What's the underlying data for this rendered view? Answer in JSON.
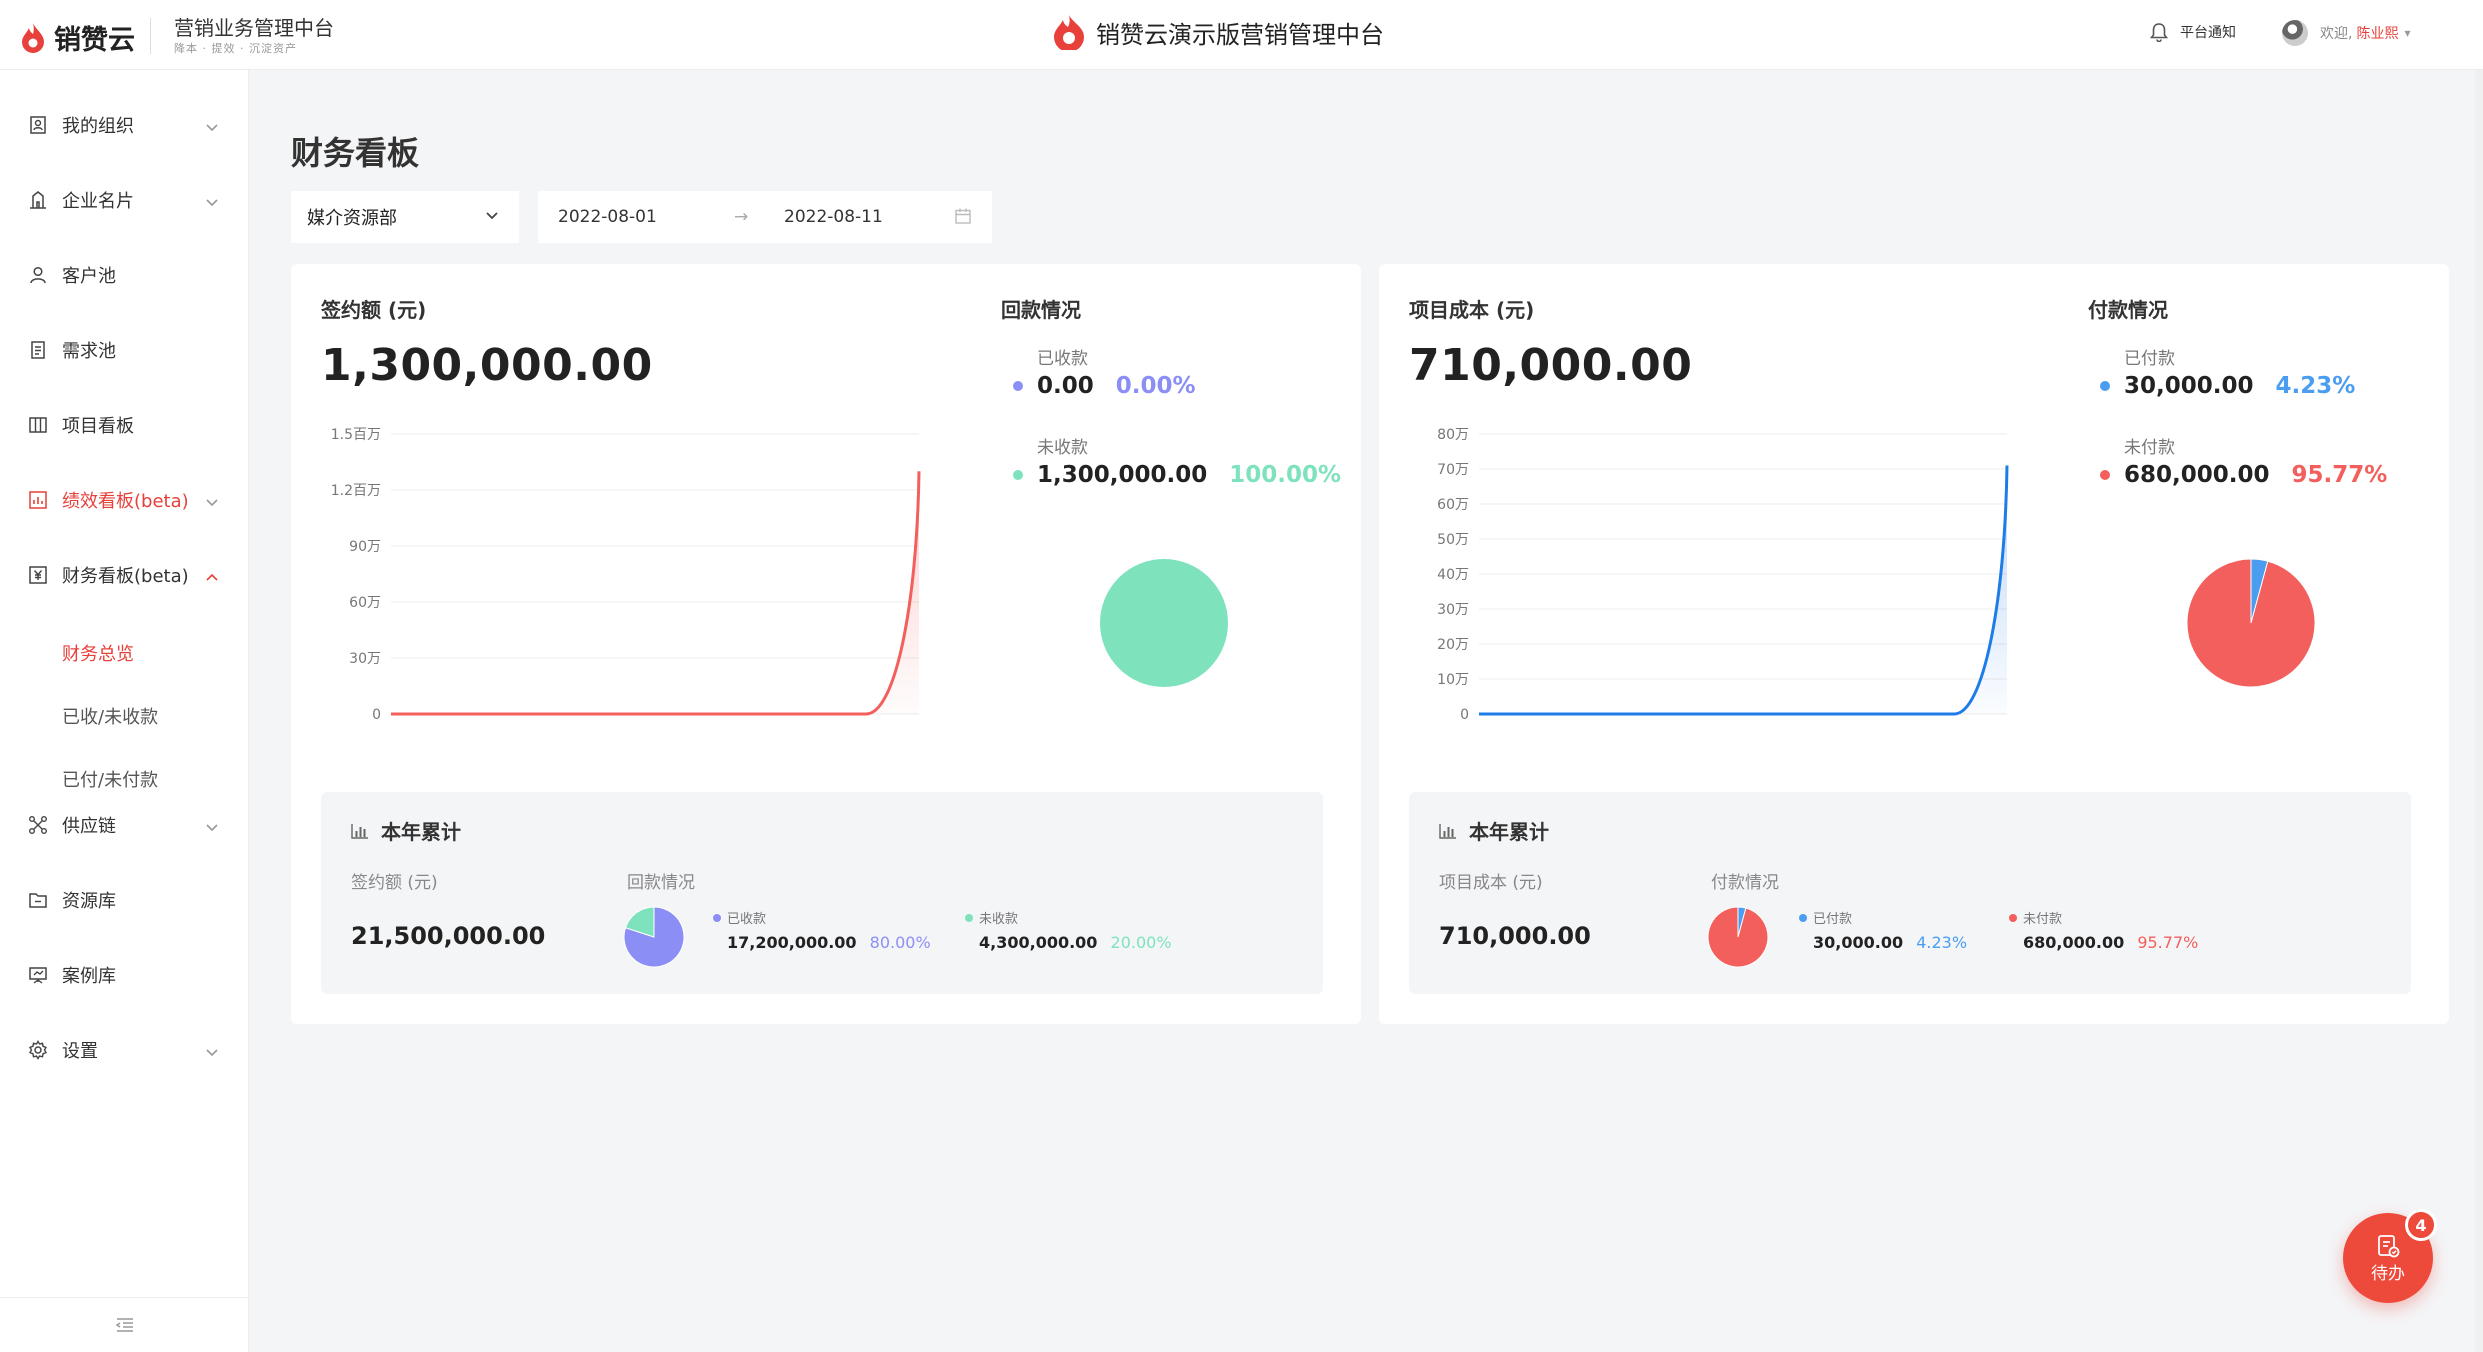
{
  "header": {
    "logo_text": "销赞云",
    "system_name": "营销业务管理中台",
    "system_sub": "降本 · 提效 · 沉淀资产",
    "center_title": "销赞云演示版营销管理中台",
    "notice_label": "平台通知",
    "welcome": "欢迎,",
    "user_name": "陈业熙"
  },
  "sidebar": {
    "items": [
      {
        "label": "我的组织",
        "icon": "org-icon",
        "expandable": true
      },
      {
        "label": "企业名片",
        "icon": "building-icon",
        "expandable": true
      },
      {
        "label": "客户池",
        "icon": "user-icon",
        "expandable": false
      },
      {
        "label": "需求池",
        "icon": "document-icon",
        "expandable": false
      },
      {
        "label": "项目看板",
        "icon": "board-icon",
        "expandable": false
      },
      {
        "label": "绩效看板(beta)",
        "icon": "performance-chart-icon",
        "expandable": true
      },
      {
        "label": "财务看板(beta)",
        "icon": "finance-icon",
        "expandable": true,
        "expanded": true
      },
      {
        "label": "供应链",
        "icon": "supply-chain-icon",
        "expandable": true
      },
      {
        "label": "资源库",
        "icon": "folder-icon",
        "expandable": false
      },
      {
        "label": "案例库",
        "icon": "presentation-icon",
        "expandable": false
      },
      {
        "label": "设置",
        "icon": "gear-icon",
        "expandable": true
      }
    ],
    "sub_items": [
      {
        "label": "财务总览",
        "active": true
      },
      {
        "label": "已收/未收款",
        "active": false
      },
      {
        "label": "已付/未付款",
        "active": false
      }
    ]
  },
  "main": {
    "page_title": "财务看板",
    "department_select": "媒介资源部",
    "date_start": "2022-08-01",
    "date_end": "2022-08-11"
  },
  "colors": {
    "brand": "#e8403a",
    "received": "#8b8ff5",
    "unreceived": "#7ee3bd",
    "paid": "#4a9df0",
    "unpaid": "#f25f5c",
    "contract_line": "#f25f5c",
    "cost_line": "#1e7ce8"
  },
  "left_card": {
    "metric_label": "签约额 (元)",
    "metric_value": "1,300,000.00",
    "payment_title": "回款情况",
    "entries": [
      {
        "label": "已收款",
        "amount": "0.00",
        "percent": "0.00%"
      },
      {
        "label": "未收款",
        "amount": "1,300,000.00",
        "percent": "100.00%"
      }
    ],
    "ytd": {
      "title": "本年累计",
      "metric_label": "签约额 (元)",
      "metric_value": "21,500,000.00",
      "payment_label": "回款情况",
      "entries": [
        {
          "label": "已收款",
          "amount": "17,200,000.00",
          "percent": "80.00%"
        },
        {
          "label": "未收款",
          "amount": "4,300,000.00",
          "percent": "20.00%"
        }
      ]
    }
  },
  "right_card": {
    "metric_label": "项目成本 (元)",
    "metric_value": "710,000.00",
    "payment_title": "付款情况",
    "entries": [
      {
        "label": "已付款",
        "amount": "30,000.00",
        "percent": "4.23%"
      },
      {
        "label": "未付款",
        "amount": "680,000.00",
        "percent": "95.77%"
      }
    ],
    "ytd": {
      "title": "本年累计",
      "metric_label": "项目成本 (元)",
      "metric_value": "710,000.00",
      "payment_label": "付款情况",
      "entries": [
        {
          "label": "已付款",
          "amount": "30,000.00",
          "percent": "4.23%"
        },
        {
          "label": "未付款",
          "amount": "680,000.00",
          "percent": "95.77%"
        }
      ]
    }
  },
  "todo": {
    "label": "待办",
    "count": "4"
  },
  "chart_data": [
    {
      "type": "area",
      "ylim": [
        0,
        1500000
      ],
      "y_ticks": [
        "0",
        "30万",
        "60万",
        "90万",
        "1.2百万",
        "1.5百万"
      ],
      "y_tick_values": [
        0,
        300000,
        600000,
        900000,
        1200000,
        1500000
      ],
      "x": [
        0,
        1,
        2,
        3,
        4,
        5,
        6,
        7,
        8,
        9,
        10
      ],
      "series": [
        {
          "values": [
            0,
            0,
            0,
            0,
            0,
            0,
            0,
            0,
            0,
            0,
            1300000
          ]
        }
      ]
    },
    {
      "type": "pie",
      "labels": [
        "已收款",
        "未收款"
      ],
      "values": [
        0,
        100
      ]
    },
    {
      "type": "area",
      "ylim": [
        0,
        800000
      ],
      "y_ticks": [
        "0",
        "10万",
        "20万",
        "30万",
        "40万",
        "50万",
        "60万",
        "70万",
        "80万"
      ],
      "y_tick_values": [
        0,
        100000,
        200000,
        300000,
        400000,
        500000,
        600000,
        700000,
        800000
      ],
      "x": [
        0,
        1,
        2,
        3,
        4,
        5,
        6,
        7,
        8,
        9,
        10
      ],
      "series": [
        {
          "values": [
            0,
            0,
            0,
            0,
            0,
            0,
            0,
            0,
            0,
            0,
            710000
          ]
        }
      ]
    },
    {
      "type": "pie",
      "labels": [
        "已付款",
        "未付款"
      ],
      "values": [
        4.23,
        95.77
      ]
    },
    {
      "type": "pie",
      "labels": [
        "已收款",
        "未收款"
      ],
      "values": [
        80,
        20
      ]
    },
    {
      "type": "pie",
      "labels": [
        "已付款",
        "未付款"
      ],
      "values": [
        4.23,
        95.77
      ]
    }
  ]
}
